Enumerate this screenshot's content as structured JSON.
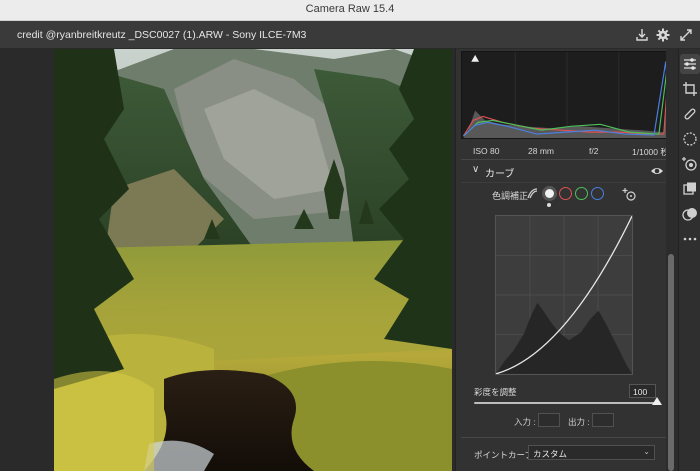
{
  "app": {
    "title": "Camera Raw 15.4"
  },
  "file": {
    "label": "credit @ryanbreitkreutz _DSC0027 (1).ARW  -  Sony ILCE-7M3"
  },
  "icons": [
    "save-icon",
    "gear-icon",
    "expand-icon",
    "edit-sliders-icon",
    "crop-icon",
    "healing-icon",
    "masking-icon",
    "redeye-icon",
    "snapshots-icon",
    "presets-icon",
    "more-icon",
    "eye-icon",
    "channel-parametric-icon",
    "point-curve-icon",
    "target-adjust-icon"
  ],
  "exif": {
    "iso": "ISO 80",
    "focal": "28 mm",
    "aperture": "f/2",
    "shutter": "1/1000 秒"
  },
  "curve_section": {
    "title": "カーブ",
    "tone_label": "色調補正"
  },
  "saturation": {
    "label": "彩度を調整",
    "value": "100",
    "level_percent": 100
  },
  "io": {
    "input_label": "入力 :",
    "output_label": "出力 :"
  },
  "point_curve": {
    "label": "ポイントカーブ",
    "selected": "カスタム"
  },
  "colors": {
    "accent": "#3b82f6",
    "red": "#e05252",
    "green": "#4cc15a",
    "blue": "#4a7fe0"
  }
}
